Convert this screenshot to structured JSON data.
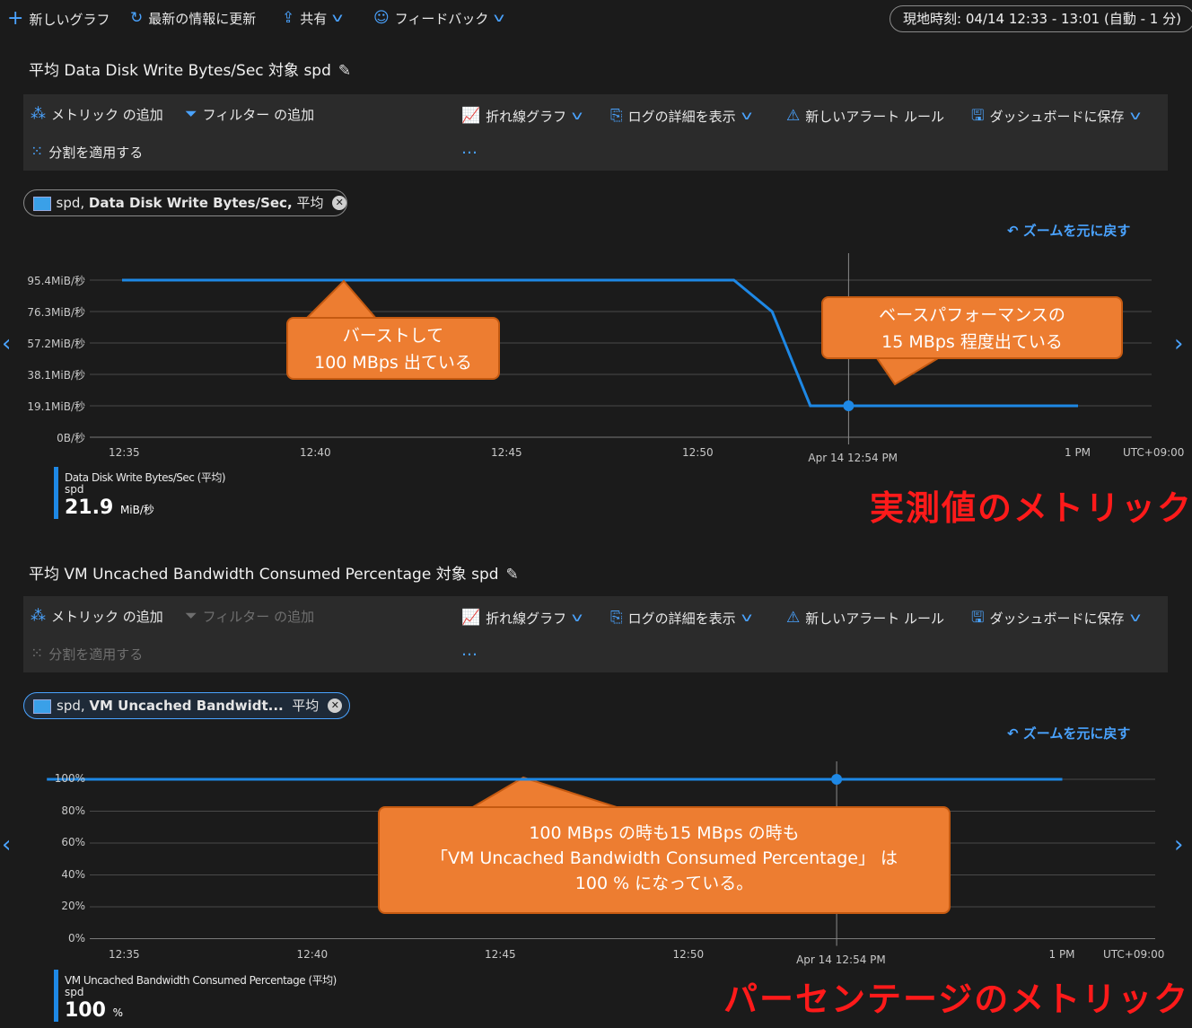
{
  "topbar": {
    "new_chart": "新しいグラフ",
    "refresh": "最新の情報に更新",
    "share": "共有",
    "feedback": "フィードバック",
    "time_range": "現地時刻: 04/14 12:33 - 13:01 (自動 - 1 分)"
  },
  "toolbar": {
    "add_metric": "メトリック の追加",
    "add_filter": "フィルター の追加",
    "line_chart": "折れ線グラフ",
    "view_logs": "ログの詳細を表示",
    "new_alert": "新しいアラート ルール",
    "save_dashboard": "ダッシュボードに保存",
    "apply_split": "分割を適用する",
    "more": "…"
  },
  "zoom_reset": "ズームを元に戻す",
  "chart1": {
    "title": "平均 Data Disk Write Bytes/Sec 対象 spd",
    "pill_prefix": "spd,",
    "pill_metric": "Data Disk Write Bytes/Sec,",
    "pill_agg": "平均",
    "legend_name": "Data Disk Write Bytes/Sec (平均)",
    "legend_resource": "spd",
    "legend_value": "21.9",
    "legend_unit": "MiB/秒",
    "callout_left_1": "バーストして",
    "callout_left_2": "100 MBps 出ている",
    "callout_right_1": "ベースパフォーマンスの",
    "callout_right_2": "15 MBps 程度出ている",
    "red_label": "実測値のメトリック"
  },
  "chart2": {
    "title": "平均 VM Uncached Bandwidth Consumed Percentage 対象 spd",
    "pill_prefix": "spd,",
    "pill_metric": "VM Uncached Bandwidt...",
    "pill_agg": "平均",
    "legend_name": "VM Uncached Bandwidth Consumed Percentage (平均)",
    "legend_resource": "spd",
    "legend_value": "100",
    "legend_unit": "%",
    "callout_1": "100 MBps の時も15 MBps の時も",
    "callout_2": "「VM Uncached Bandwidth Consumed Percentage」 は",
    "callout_3": "100 % になっている。",
    "red_label": "パーセンテージのメトリック"
  },
  "chart_data": [
    {
      "type": "line",
      "x": [
        "12:35",
        "12:40",
        "12:45",
        "12:50",
        "12:51",
        "12:52",
        "12:53",
        "12:54",
        "13:00"
      ],
      "series": [
        {
          "values": [
            95.4,
            95.4,
            95.4,
            95.4,
            95.4,
            76.3,
            19.1,
            19.1,
            19.1
          ]
        }
      ],
      "y_ticks": [
        "95.4MiB/秒",
        "76.3MiB/秒",
        "57.2MiB/秒",
        "38.1MiB/秒",
        "19.1MiB/秒",
        "0B/秒"
      ],
      "x_ticks": [
        "12:35",
        "12:40",
        "12:45",
        "12:50",
        "1 PM"
      ],
      "cursor_label": "Apr 14 12:54 PM",
      "timezone": "UTC+09:00",
      "ylim": [
        0,
        95.4
      ],
      "grid": true
    },
    {
      "type": "line",
      "x": [
        "12:33",
        "13:00"
      ],
      "series": [
        {
          "values": [
            100,
            100
          ]
        }
      ],
      "y_ticks": [
        "100%",
        "80%",
        "60%",
        "40%",
        "20%",
        "0%"
      ],
      "x_ticks": [
        "12:35",
        "12:40",
        "12:45",
        "12:50",
        "1 PM"
      ],
      "cursor_label": "Apr 14 12:54 PM",
      "timezone": "UTC+09:00",
      "ylim": [
        0,
        100
      ],
      "grid": true
    }
  ]
}
